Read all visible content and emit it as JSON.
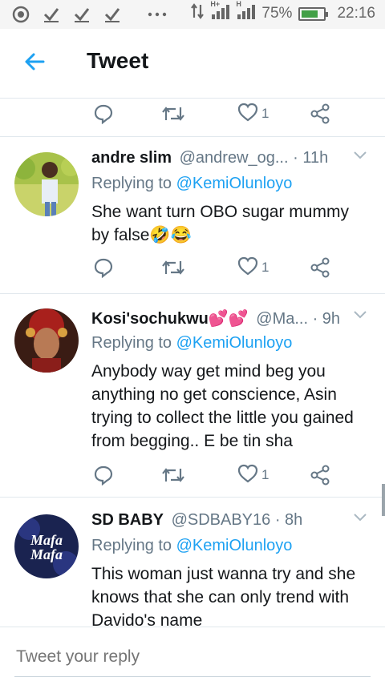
{
  "status_bar": {
    "signal_1": "H+",
    "signal_2": "H",
    "battery": "75%",
    "time": "22:16",
    "battery_level": 0.75
  },
  "header": {
    "title": "Tweet"
  },
  "top_actions": {
    "like_count": "1"
  },
  "tweets": [
    {
      "name": "andre slim",
      "handle_time": "@andrew_og... · 11h",
      "replying_prefix": "Replying to ",
      "replying_handle": "@KemiOlunloyo",
      "text": "She want turn OBO sugar mummy by false🤣😂",
      "like_count": "1"
    },
    {
      "name": "Kosi'sochukwu💕💕",
      "handle_time": "@Ma... · 9h",
      "replying_prefix": "Replying to ",
      "replying_handle": "@KemiOlunloyo",
      "text": "Anybody way get mind beg you anything no get conscience, Asin trying to collect the little you gained from begging.. E be tin sha",
      "like_count": "1"
    },
    {
      "name": "SD BABY",
      "handle_time": "@SDBABY16 · 8h",
      "replying_prefix": "Replying to ",
      "replying_handle": "@KemiOlunloyo",
      "text": "This woman just wanna try and she knows that she can only trend with Davido's name",
      "avatar_text_1": "Mafa",
      "avatar_text_2": "Mafa"
    }
  ],
  "reply": {
    "placeholder": "Tweet your reply"
  },
  "colors": {
    "accent": "#1da1f2",
    "secondary_text": "#657786",
    "divider": "#e1e8ed"
  }
}
